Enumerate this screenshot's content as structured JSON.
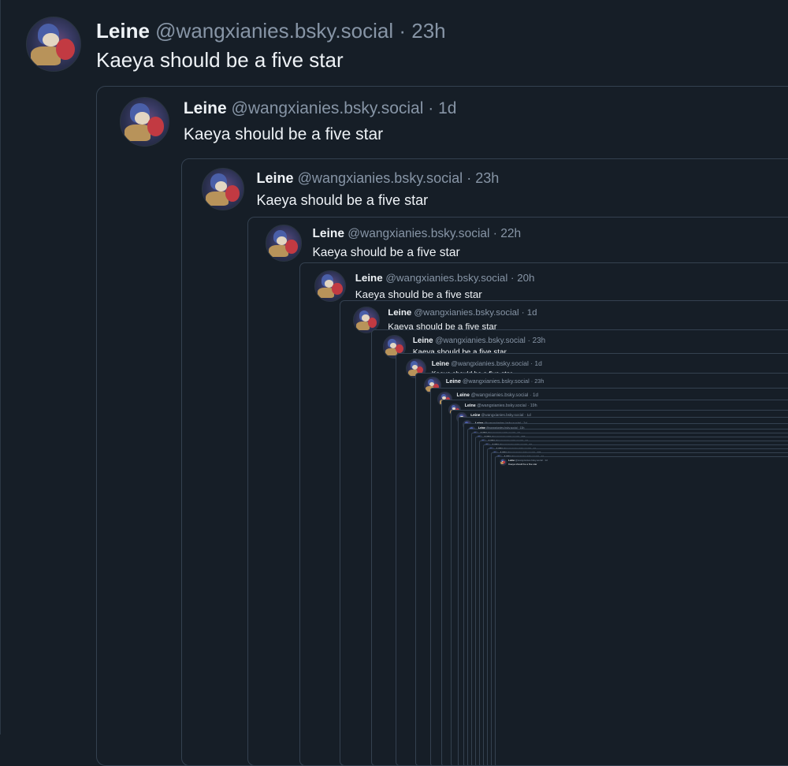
{
  "post": {
    "name": "Leine",
    "handle": "@wangxianies.bsky.social",
    "time": "23h",
    "text": "Kaeya should be a five star"
  },
  "quotes": [
    {
      "name": "Leine",
      "handle": "@wangxianies.bsky.social",
      "time": "1d",
      "text": "Kaeya should be a five star"
    },
    {
      "name": "Leine",
      "handle": "@wangxianies.bsky.social",
      "time": "23h",
      "text": "Kaeya should be a five star"
    },
    {
      "name": "Leine",
      "handle": "@wangxianies.bsky.social",
      "time": "22h",
      "text": "Kaeya should be a five star"
    },
    {
      "name": "Leine",
      "handle": "@wangxianies.bsky.social",
      "time": "20h",
      "text": "Kaeya should be a five star"
    },
    {
      "name": "Leine",
      "handle": "@wangxianies.bsky.social",
      "time": "1d",
      "text": "Kaeya should be a five star"
    },
    {
      "name": "Leine",
      "handle": "@wangxianies.bsky.social",
      "time": "23h",
      "text": "Kaeya should be a five star"
    },
    {
      "name": "Leine",
      "handle": "@wangxianies.bsky.social",
      "time": "1d",
      "text": "Kaeya should be a five star"
    },
    {
      "name": "Leine",
      "handle": "@wangxianies.bsky.social",
      "time": "23h",
      "text": ""
    },
    {
      "name": "Leine",
      "handle": "@wangxianies.bsky.social",
      "time": "1d",
      "text": "Kaeya should be a five star"
    },
    {
      "name": "Leine",
      "handle": "@wangxianies.bsky.social",
      "time": "19h",
      "text": "Kaeya should be a five star"
    },
    {
      "name": "Leine",
      "handle": "@wangxianies.bsky.social",
      "time": "1d",
      "text": "Kaeya should be a five star"
    },
    {
      "name": "Leine",
      "handle": "@wangxianies.bsky.social",
      "time": "2d",
      "text": "Kaeya should be a five star because I made two snowmen"
    },
    {
      "name": "Leine",
      "handle": "@wangxianies.bsky.social",
      "time": "13h",
      "text": "Kaeya should be a five star because it snowed today"
    },
    {
      "name": "Leine",
      "handle": "@wangxianies.bsky.social",
      "time": "1d",
      "text": "Kaeya should be a five star because it's my birthday"
    },
    {
      "name": "Leine",
      "handle": "@wangxianies.bsky.social",
      "time": "23h",
      "text": "Kaeya should be a five star"
    },
    {
      "name": "Leine",
      "handle": "@wangxianies.bsky.social",
      "time": "1d",
      "text": "Kaeya should be a five star"
    },
    {
      "name": "Leine",
      "handle": "@wangxianies.bsky.social",
      "time": "2d",
      "text": "Kaeya should be a five star"
    },
    {
      "name": "Leine",
      "handle": "@wangxianies.bsky.social",
      "time": "1d",
      "text": "Kaeya should be a five star"
    },
    {
      "name": "Leine",
      "handle": "@wangxianies.bsky.social",
      "time": "23h",
      "text": "Kaeya should be a five star"
    },
    {
      "name": "Leine",
      "handle": "@wangxianies.bsky.social",
      "time": "1d",
      "text": "Kaeya should be a five star"
    },
    {
      "name": "Leine",
      "handle": "@wangxianies.bsky.social",
      "time": "1d",
      "text": "Kaeya should be a five star"
    }
  ],
  "separator": "·",
  "colors": {
    "background": "#161e27",
    "card_border": "#344150",
    "text_primary": "#eef2f6",
    "text_secondary": "#8795a6"
  },
  "icons": {
    "avatar": "avatar-image"
  }
}
